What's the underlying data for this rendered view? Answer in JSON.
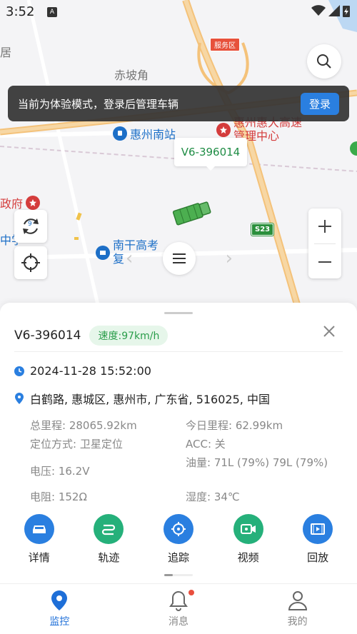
{
  "status_bar": {
    "time": "3:52",
    "notif_icon": "A"
  },
  "map": {
    "labels": {
      "chipoiao": "赤坡角",
      "left_edge": "居",
      "huizhou_south": "惠州南站",
      "expressway_center": "惠州惠大高速管理中心",
      "government": "政府",
      "middle_school": "中学",
      "nanhu_gaosu": "南干高考",
      "fu": "复"
    },
    "service_area": "服务区",
    "road_badge": "S23",
    "plate_bubble": "V6-396014",
    "rotate_count": "9"
  },
  "toast": {
    "message": "当前为体验模式，登录后管理车辆",
    "login_label": "登录"
  },
  "vehicle": {
    "plate": "V6-396014",
    "speed": "速度:97km/h",
    "time": "2024-11-28 15:52:00",
    "address": "白鹤路, 惠城区, 惠州市, 广东省, 516025, 中国",
    "stats": {
      "total_mileage": "总里程: 28065.92km",
      "today_mileage": "今日里程: 62.99km",
      "positioning": "定位方式: 卫星定位",
      "acc": "ACC: 关",
      "voltage": "电压: 16.2V",
      "fuel": "油量: 71L (79%) 79L (79%)",
      "resistance": "电阻: 152Ω",
      "humidity": "湿度: 34℃"
    }
  },
  "actions": [
    {
      "label": "详情",
      "color": "#2a7fe0"
    },
    {
      "label": "轨迹",
      "color": "#25b07a"
    },
    {
      "label": "追踪",
      "color": "#2a7fe0"
    },
    {
      "label": "视频",
      "color": "#25b07a"
    },
    {
      "label": "回放",
      "color": "#2a7fe0"
    }
  ],
  "tabs": [
    {
      "label": "监控"
    },
    {
      "label": "消息"
    },
    {
      "label": "我的"
    }
  ]
}
